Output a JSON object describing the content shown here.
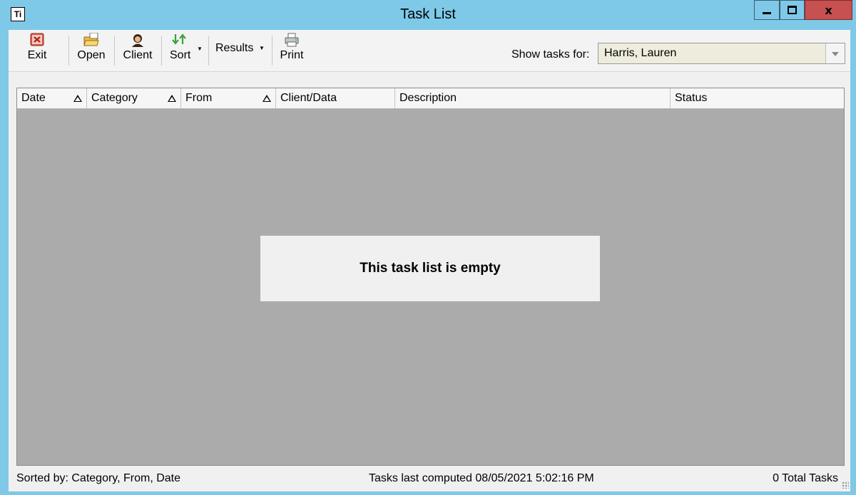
{
  "window": {
    "title": "Task List",
    "app_icon": "Ti"
  },
  "toolbar": {
    "exit": "Exit",
    "open": "Open",
    "client": "Client",
    "sort": "Sort",
    "results": "Results",
    "print": "Print",
    "show_tasks_label": "Show tasks for:",
    "show_tasks_value": "Harris, Lauren"
  },
  "grid": {
    "columns": [
      "Date",
      "Category",
      "From",
      "Client/Data",
      "Description",
      "Status"
    ],
    "empty_message": "This task list is empty"
  },
  "status": {
    "sorted_by": "Sorted by: Category, From, Date",
    "last_computed": "Tasks last computed 08/05/2021 5:02:16 PM",
    "total": "0 Total Tasks"
  },
  "colors": {
    "titlebar": "#7fc9e8",
    "close_button": "#c75050",
    "grid_background": "#ababab",
    "combo_background": "#eeecdd"
  }
}
